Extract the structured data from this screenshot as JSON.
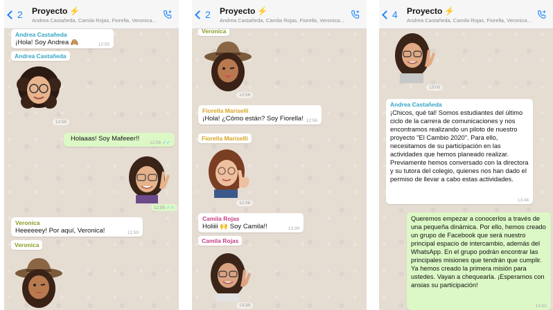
{
  "header": {
    "title": "Proyecto",
    "bolt": "⚡",
    "subtitle": "Andrea Castañeda, Camila Rojas, Fiorella, Veronica..."
  },
  "colors": {
    "andrea": "#35a5c4",
    "fiorella": "#d9a520",
    "veronica": "#8a9a1e",
    "camila": "#c43f86",
    "outgoing_bubble": "#dcf8c6",
    "accent": "#1a84ff"
  },
  "panels": [
    {
      "back_count": "2",
      "messages": {
        "andrea_name": "Andrea Castañeda",
        "andrea_text": "¡Hola! Soy Andrea 🙈",
        "andrea_time": "12:55",
        "andrea_tag": "Andrea Castañeda",
        "andrea_sticker_time": "12:55",
        "me_text": "Holaaas! Soy Mafeeer!!",
        "me_time": "12:56",
        "me_sticker_time": "12:55",
        "veronica_name": "Veronica",
        "veronica_text": "Heeeeeey! Por aquí, Veronica!",
        "veronica_time": "12:59",
        "veronica_tag": "Veronica"
      }
    },
    {
      "back_count": "2",
      "messages": {
        "veronica_tag": "Veronica",
        "veronica_sticker_time": "12:56",
        "fiorella_name": "Fiorella Mariselli",
        "fiorella_text": "¡Hola! ¿Cómo están? Soy Fiorella!",
        "fiorella_time": "12:56",
        "fiorella_tag": "Fiorella Mariselli",
        "fiorella_sticker_time": "12:56",
        "camila_name": "Camila Rojas",
        "camila_text": "Holiiii 🙌 Soy Camila!!",
        "camila_time": "13:39",
        "camila_tag": "Camila Rojas",
        "camila_sticker_time": "13:39"
      }
    },
    {
      "back_count": "4",
      "messages": {
        "sticker_time": "13:00",
        "andrea_name": "Andrea Castañeda",
        "andrea_text": "¡Chicos, qué tal! Somos estudiantes del último ciclo de la carrera de comunicaciones y nos encontramos realizando un piloto de nuestro proyecto \"El Cambio 2020\". Para ello, necesitamos de su participación en las actividades que hemos planeado realizar. Previamente hemos conversado con la directora y su tutora del colegio, quienes nos han dado el permiso de llevar a cabo estas actividades.",
        "andrea_time": "13:48",
        "me_text": "Queremos empezar a conocerlos a través de una pequeña dinámica. Por ello, hemos creado un grupo de Facebook que será nuestro principal espacio de intercambio, además del WhatsApp. En el grupo podrán encontrar las principales misiones que tendrán que cumplir. Ya hemos creado la primera misión para ustedes. Vayan a chequearla. ¡Esperamos con ansias su participación!",
        "me_time": "13:50"
      }
    }
  ]
}
